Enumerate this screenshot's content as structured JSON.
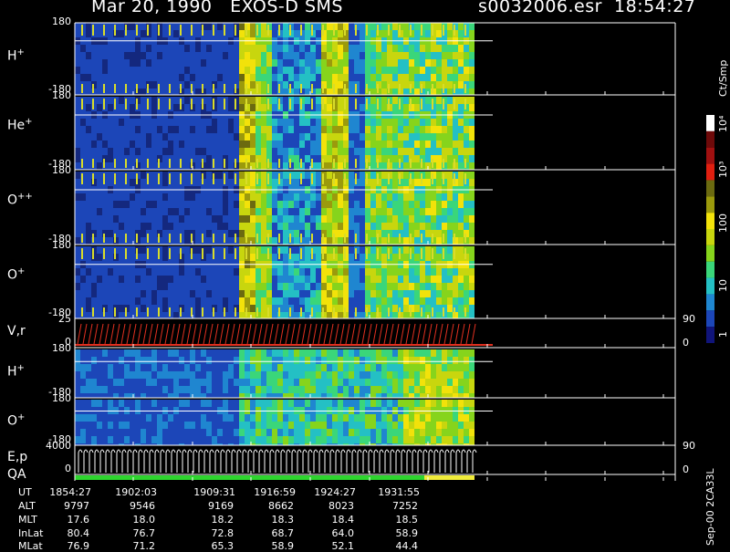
{
  "header": {
    "title": "Mar 20, 1990   EXOS-D SMS",
    "file_time": "s0032006.esr  18:54:27"
  },
  "panels": [
    {
      "label_main": "H",
      "label_sup": "+",
      "top_tick": "180",
      "bottom_tick": "-180"
    },
    {
      "label_main": "He",
      "label_sup": "+",
      "top_tick": "180",
      "bottom_tick": "-180"
    },
    {
      "label_main": "O",
      "label_sup": "++",
      "top_tick": "180",
      "bottom_tick": "-180"
    },
    {
      "label_main": "O",
      "label_sup": "+",
      "top_tick": "180",
      "bottom_tick": "-180"
    },
    {
      "label_main": "V,r",
      "label_sup": "",
      "top_tick": "25",
      "bottom_tick": "0",
      "right_top": "90",
      "right_bottom": "0"
    },
    {
      "label_main": "H",
      "label_sup": "+",
      "top_tick": "180",
      "bottom_tick": "-180"
    },
    {
      "label_main": "O",
      "label_sup": "+",
      "top_tick": "180",
      "bottom_tick": "-180"
    },
    {
      "label_main": "E,p",
      "label_sup": "",
      "top_tick": "4000",
      "bottom_tick": "0",
      "right_top": "90",
      "right_bottom": "0"
    },
    {
      "label_main": "QA",
      "label_sup": ""
    }
  ],
  "colorbar": {
    "unit": "Ct/Smp",
    "ticks": [
      "1",
      "10",
      "100",
      "10³",
      "10⁴"
    ],
    "colors": [
      "#10147a",
      "#1c46b8",
      "#1f86d0",
      "#24c0c4",
      "#3ad67a",
      "#86d41c",
      "#c8d60e",
      "#f2e20a",
      "#9b9a0c",
      "#6b6a10",
      "#e01f10",
      "#a01010",
      "#6e0a0a",
      "#ffffff"
    ]
  },
  "time_table": {
    "rows": [
      {
        "label": "UT",
        "values": [
          "1854:27",
          "1902:03",
          "1909:31",
          "1916:59",
          "1924:27",
          "1931:55"
        ]
      },
      {
        "label": "ALT",
        "values": [
          "9797",
          "9546",
          "9169",
          "8662",
          "8023",
          "7252"
        ]
      },
      {
        "label": "MLT",
        "values": [
          "17.6",
          "18.0",
          "18.2",
          "18.3",
          "18.4",
          "18.5"
        ]
      },
      {
        "label": "InLat",
        "values": [
          "80.4",
          "76.7",
          "72.8",
          "68.7",
          "64.0",
          "58.9"
        ]
      },
      {
        "label": "MLat",
        "values": [
          "76.9",
          "71.2",
          "65.3",
          "58.9",
          "52.1",
          "44.4"
        ]
      }
    ]
  },
  "side_label": "Sep-00  2CA33L",
  "chart_data": {
    "type": "heatmap",
    "title": "Mar 20, 1990   EXOS-D SMS",
    "x_ticks": [
      "1854:27",
      "1902:03",
      "1909:31",
      "1916:59",
      "1924:27",
      "1931:55"
    ],
    "series": [
      {
        "name": "H+",
        "ylim": [
          -180,
          180
        ]
      },
      {
        "name": "He+",
        "ylim": [
          -180,
          180
        ]
      },
      {
        "name": "O++",
        "ylim": [
          -180,
          180
        ]
      },
      {
        "name": "O+",
        "ylim": [
          -180,
          180
        ]
      },
      {
        "name": "V,r",
        "ylim": [
          0,
          25
        ],
        "right_ylim": [
          0,
          90
        ]
      },
      {
        "name": "H+",
        "ylim": [
          -180,
          180
        ]
      },
      {
        "name": "O+",
        "ylim": [
          -180,
          180
        ]
      },
      {
        "name": "E,p",
        "ylim": [
          0,
          4000
        ],
        "right_ylim": [
          0,
          90
        ]
      },
      {
        "name": "QA"
      }
    ],
    "colorbar_scale": "log",
    "colorbar_range": [
      1,
      10000
    ],
    "colorbar_label": "Ct/Smp"
  }
}
